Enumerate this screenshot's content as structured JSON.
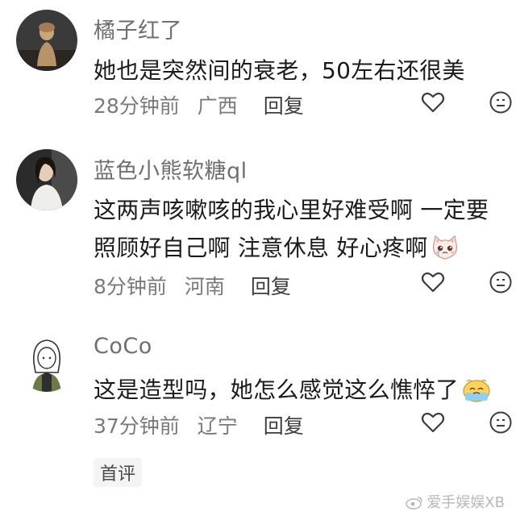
{
  "comments": [
    {
      "username": "橘子红了",
      "lines": [
        "她也是突然间的衰老，50左右还很美"
      ],
      "time": "28分钟前",
      "location": "广西",
      "reply_label": "回复",
      "avatar_icon": "figurine-avatar"
    },
    {
      "username": "蓝色小熊软糖ql",
      "lines": [
        "这两声咳嗽咳的我心里好难受啊 一定要",
        "照顾好自己啊 注意休息 好心疼啊"
      ],
      "time": "8分钟前",
      "location": "河南",
      "reply_label": "回复",
      "avatar_icon": "woman-photo-avatar",
      "emoji_icon": "crying-cat-emoji"
    },
    {
      "username": "CoCo",
      "lines": [
        "这是造型吗，她怎么感觉这么憔悴了"
      ],
      "time": "37分钟前",
      "location": "辽宁",
      "reply_label": "回复",
      "avatar_icon": "cartoon-girl-avatar",
      "emoji_icon": "tired-emoji"
    }
  ],
  "footer": {
    "link": "首评"
  },
  "watermark": "爱手娱娱XB",
  "icons": {
    "like": "heart-outline-icon",
    "react": "smiley-face-icon"
  },
  "colors": {
    "text": "#1b1b1b",
    "username": "#6f6f6f",
    "meta": "#7a7a7a"
  }
}
